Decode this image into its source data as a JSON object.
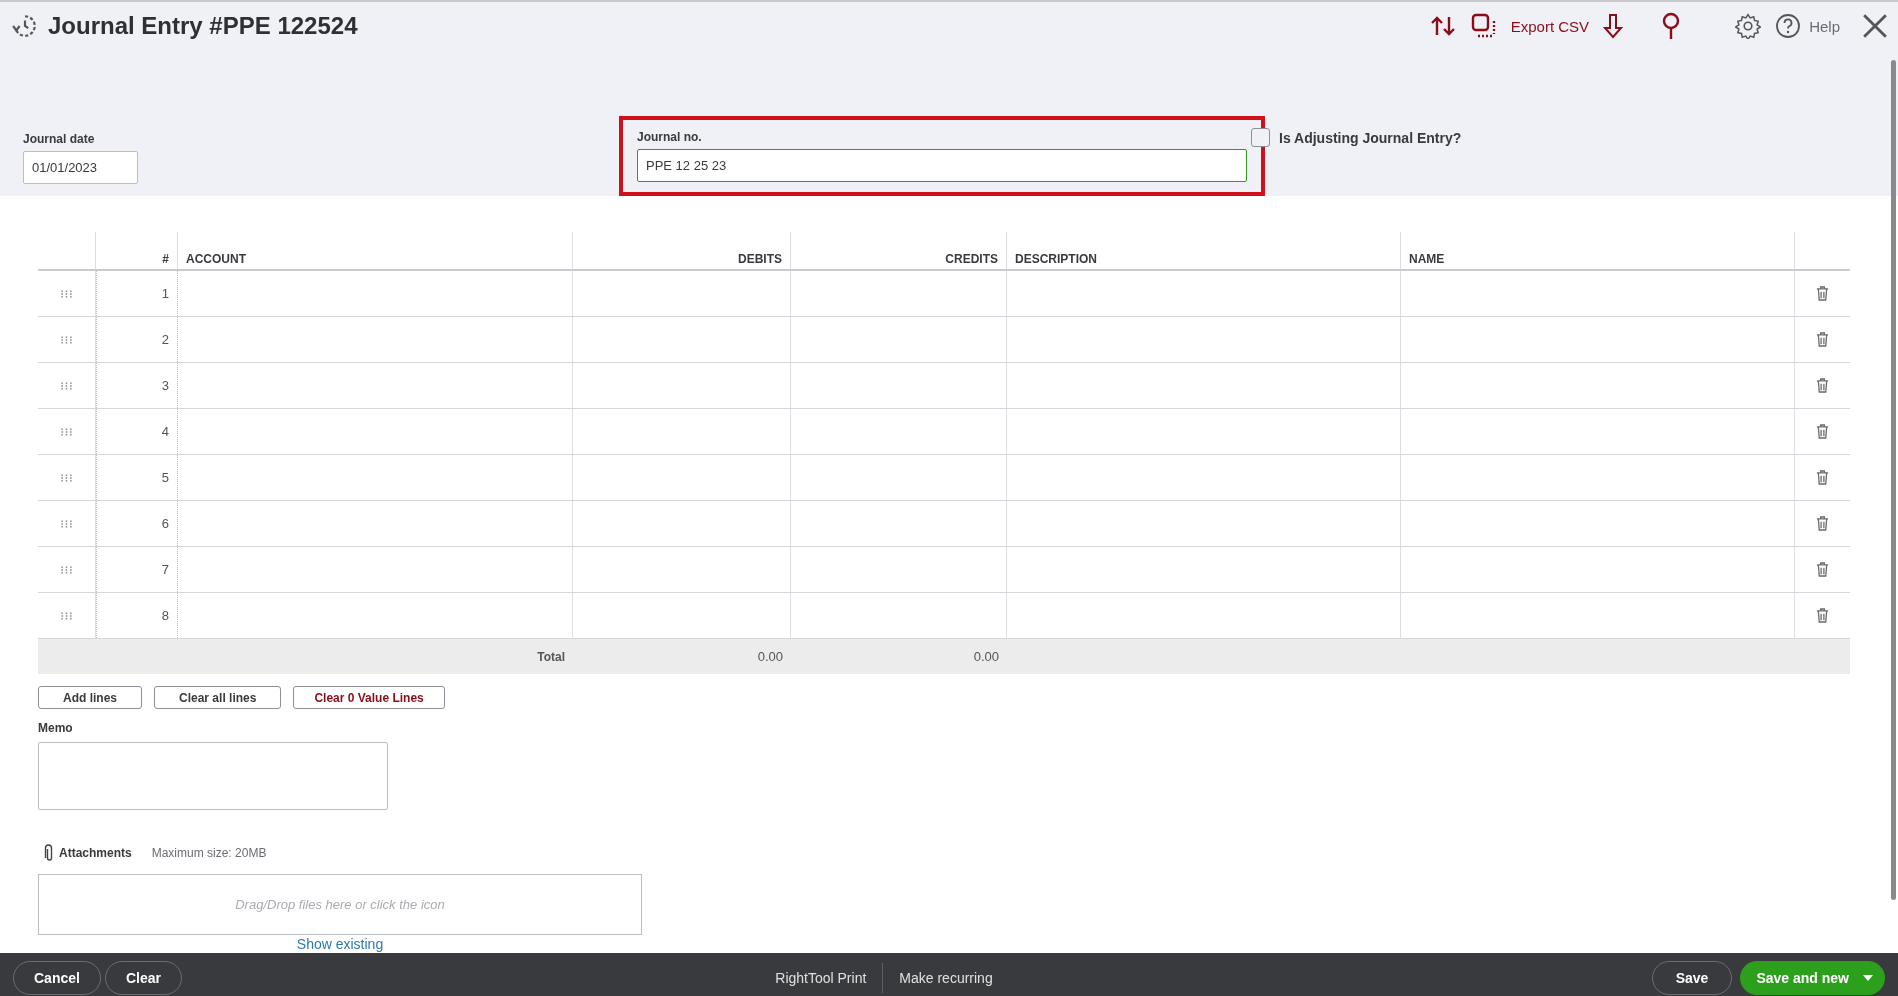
{
  "header": {
    "title": "Journal Entry #PPE 122524",
    "export_label": "Export CSV",
    "help_label": "Help"
  },
  "journal_date": {
    "label": "Journal date",
    "value": "01/01/2023"
  },
  "journal_no": {
    "label": "Journal no.",
    "value": "PPE 12 25 23"
  },
  "adjusting": {
    "label": "Is Adjusting Journal Entry?",
    "checked": false
  },
  "table": {
    "columns": [
      {
        "label": "#"
      },
      {
        "label": "ACCOUNT"
      },
      {
        "label": "DEBITS"
      },
      {
        "label": "CREDITS"
      },
      {
        "label": "DESCRIPTION"
      },
      {
        "label": "NAME"
      }
    ],
    "rows": [
      {
        "number": "1"
      },
      {
        "number": "2"
      },
      {
        "number": "3"
      },
      {
        "number": "4"
      },
      {
        "number": "5"
      },
      {
        "number": "6"
      },
      {
        "number": "7"
      },
      {
        "number": "8"
      }
    ],
    "total": {
      "label": "Total",
      "debits": "0.00",
      "credits": "0.00"
    }
  },
  "line_buttons": [
    {
      "label": "Add lines",
      "kind": "default"
    },
    {
      "label": "Clear all lines",
      "kind": "default"
    },
    {
      "label": "Clear 0 Value Lines",
      "kind": "danger"
    }
  ],
  "memo": {
    "label": "Memo"
  },
  "attachments": {
    "label": "Attachments",
    "max_size": "Maximum size: 20MB",
    "drop_placeholder": "Drag/Drop files here or click the icon",
    "link": "Show existing"
  },
  "footer": {
    "left_buttons": [
      "Cancel",
      "Clear"
    ],
    "center_links": [
      "RightTool Print",
      "Make recurring"
    ],
    "save": "Save",
    "save_and_new": "Save and new"
  }
}
